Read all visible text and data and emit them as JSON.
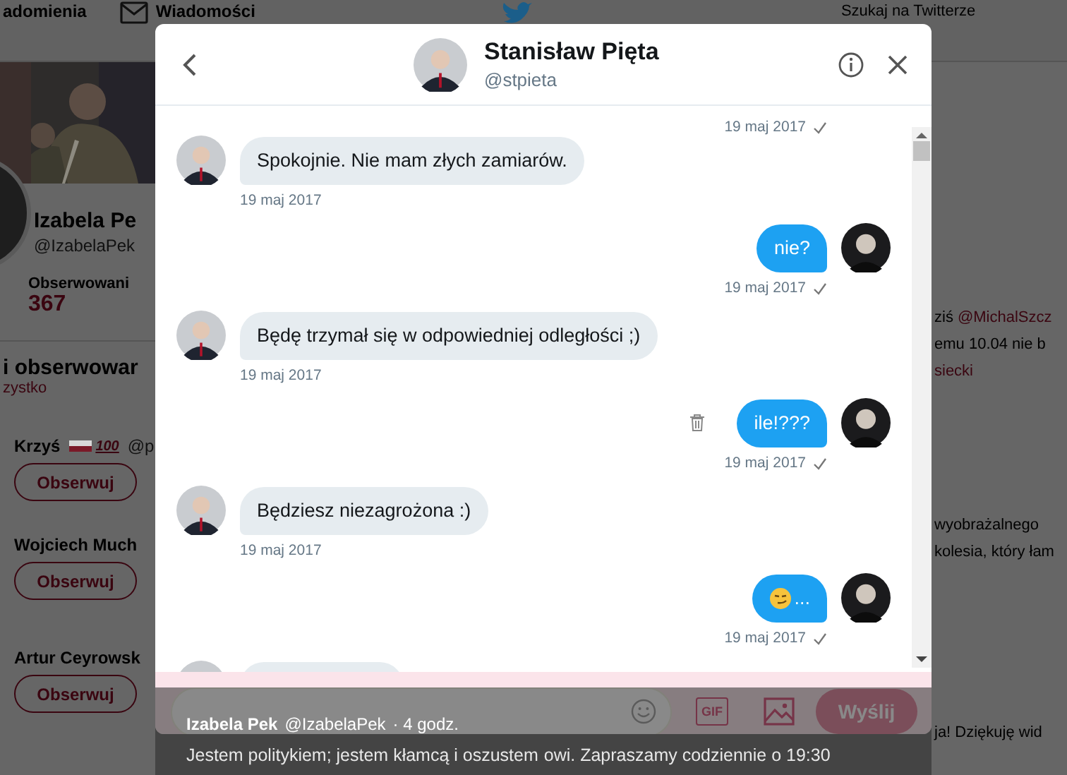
{
  "nav": {
    "items": [
      {
        "label": "adomienia"
      },
      {
        "label": "Wiadomości"
      }
    ],
    "search": {
      "placeholder": "Szukaj na Twitterze"
    }
  },
  "profile": {
    "name": "Izabela Pe",
    "handle": "@IzabelaPek",
    "stat_label": "Obserwowani",
    "stat_value": "367"
  },
  "suggestions": {
    "title": "i obserwowar",
    "link": "zystko",
    "people": [
      {
        "name": "Krzyś",
        "badge": "100",
        "handle": "@p",
        "button": "Obserwuj"
      },
      {
        "name": "Wojciech Much",
        "button": "Obserwuj"
      },
      {
        "name": "Artur Ceyrowsk",
        "button": "Obserwuj"
      }
    ]
  },
  "timeline": [
    {
      "lines": [
        [
          {
            "text": "ziś",
            "link": false
          },
          {
            "text": "@MichalSzcz",
            "link": true
          }
        ],
        [
          {
            "text": "emu 10.04 nie b",
            "link": false
          }
        ],
        [
          {
            "text": "siecki",
            "link": true
          }
        ]
      ]
    },
    {
      "lines": [
        [
          {
            "text": "wyobrażalnego",
            "link": false
          }
        ],
        [
          {
            "text": "kolesia, który łam",
            "link": false
          }
        ]
      ]
    },
    {
      "lines": [
        [
          {
            "text": "ja! Dziękuję wid",
            "link": false
          }
        ]
      ]
    }
  ],
  "conversation": {
    "title": "Stanisław Pięta",
    "handle": "@stpieta",
    "messages": [
      {
        "kind": "time_only",
        "outgoing": true,
        "time": "19 maj 2017",
        "read": true
      },
      {
        "kind": "bubble",
        "outgoing": false,
        "text": "Spokojnie. Nie mam złych zamiarów.",
        "time": "19 maj 2017"
      },
      {
        "kind": "bubble",
        "outgoing": true,
        "text": "nie?",
        "time": "19 maj 2017",
        "read": true
      },
      {
        "kind": "bubble",
        "outgoing": false,
        "text": "Będę trzymał się w odpowiedniej odległości ;)",
        "time": "19 maj 2017"
      },
      {
        "kind": "bubble",
        "outgoing": true,
        "text": "ile!???",
        "time": "19 maj 2017",
        "read": true,
        "deletable": true
      },
      {
        "kind": "bubble",
        "outgoing": false,
        "text": "Będziesz niezagrożona :)",
        "time": "19 maj 2017"
      },
      {
        "kind": "emoji_bubble",
        "outgoing": true,
        "text": "...",
        "time": "19 maj 2017",
        "read": true
      },
      {
        "kind": "cut",
        "outgoing": false
      }
    ]
  },
  "composer": {
    "gif": "GIF",
    "send": "Wyślij",
    "send_disabled": true
  },
  "overlay_tweet": {
    "name": "Izabela Pek",
    "handle": "@IzabelaPek",
    "time": "· 4 godz.",
    "text": "Jestem politykiem; jestem kłamcą i oszustem",
    "text_2": "owi. Zapraszamy codziennie o 19:30"
  }
}
